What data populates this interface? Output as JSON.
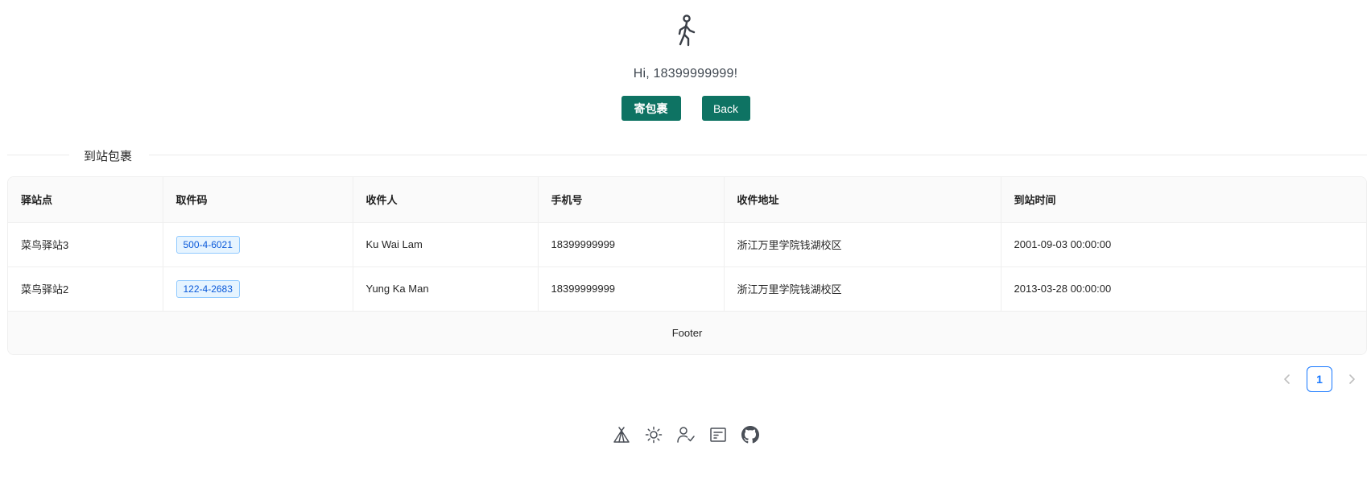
{
  "header": {
    "icon": "walking-person-icon",
    "greeting": "Hi, 18399999999!"
  },
  "actions": {
    "send_label": "寄包裹",
    "back_label": "Back"
  },
  "section": {
    "title": "到站包裹"
  },
  "table": {
    "columns": [
      "驿站点",
      "取件码",
      "收件人",
      "手机号",
      "收件地址",
      "到站时间"
    ],
    "rows": [
      {
        "station": "菜鸟驿站3",
        "code": "500-4-6021",
        "recipient": "Ku Wai Lam",
        "phone": "18399999999",
        "address": "浙江万里学院钱湖校区",
        "arrival": "2001-09-03 00:00:00"
      },
      {
        "station": "菜鸟驿站2",
        "code": "122-4-2683",
        "recipient": "Yung Ka Man",
        "phone": "18399999999",
        "address": "浙江万里学院钱湖校区",
        "arrival": "2013-03-28 00:00:00"
      }
    ],
    "footer": "Footer"
  },
  "pagination": {
    "current_page": "1",
    "prev_icon": "chevron-left-icon",
    "next_icon": "chevron-right-icon"
  },
  "footer_icons": [
    "tent-icon",
    "sun-icon",
    "user-check-icon",
    "article-icon",
    "github-icon"
  ],
  "colors": {
    "primary_button": "#0e7363",
    "tag_border": "#91caff",
    "tag_bg": "#e6f4ff",
    "tag_text": "#0958d9",
    "page_active": "#1677ff"
  }
}
